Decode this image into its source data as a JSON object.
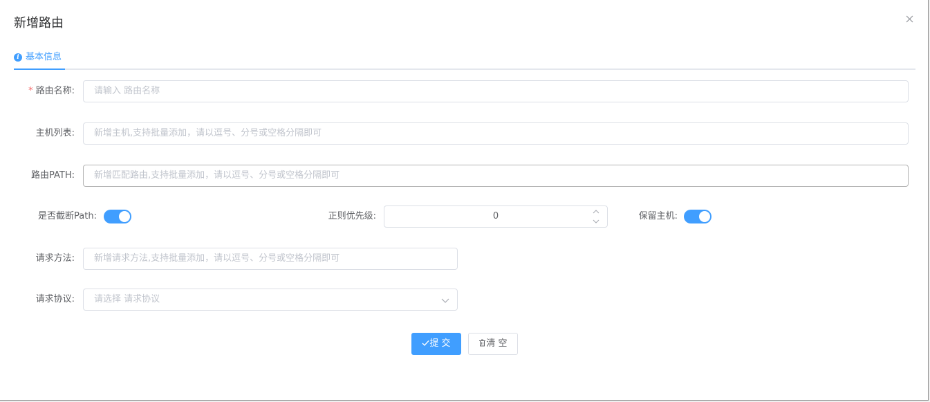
{
  "dialog": {
    "title": "新增路由"
  },
  "tabs": [
    {
      "label": "基本信息",
      "icon": "info-icon",
      "active": true
    }
  ],
  "form": {
    "route_name": {
      "label": "路由名称:",
      "required": true,
      "placeholder": "请输入 路由名称",
      "value": ""
    },
    "host_list": {
      "label": "主机列表:",
      "placeholder": "新增主机,支持批量添加，请以逗号、分号或空格分隔即可",
      "value": ""
    },
    "route_path": {
      "label": "路由PATH:",
      "placeholder": "新增匹配路由,支持批量添加，请以逗号、分号或空格分隔即可",
      "value": ""
    },
    "strip_path": {
      "label": "是否截断Path:",
      "enabled": true
    },
    "regex_priority": {
      "label": "正则优先级:",
      "value": "0"
    },
    "preserve_host": {
      "label": "保留主机:",
      "enabled": true
    },
    "request_methods": {
      "label": "请求方法:",
      "placeholder": "新增请求方法,支持批量添加，请以逗号、分号或空格分隔即可",
      "value": ""
    },
    "request_protocols": {
      "label": "请求协议:",
      "placeholder": "请选择 请求协议",
      "value": ""
    }
  },
  "actions": {
    "submit_label": "提 交",
    "clear_label": "清 空"
  },
  "colors": {
    "primary": "#409eff",
    "required": "#f56c6c",
    "border": "#dcdfe6",
    "placeholder": "#c0c4cc"
  }
}
